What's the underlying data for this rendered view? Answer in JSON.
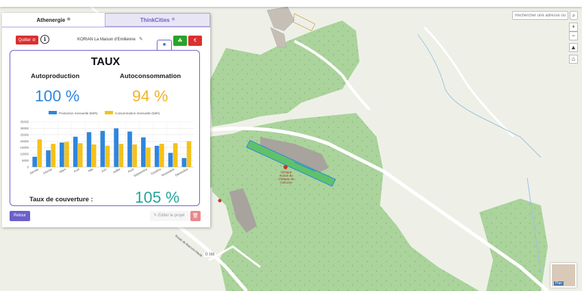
{
  "tabs": [
    {
      "label": "Athenergie",
      "icon": "registered-icon"
    },
    {
      "label": "ThinkCities",
      "icon": "registered-icon"
    }
  ],
  "toolbar": {
    "quit_label": "Quitter",
    "project_name": "KORIAN La Maison d'Emilienne"
  },
  "card": {
    "title": "TAUX",
    "autoproduction_label": "Autoproduction",
    "autoproduction_value": "100 %",
    "autoconsommation_label": "Autoconsommation",
    "autoconsommation_value": "94 %",
    "taux_label": "Taux de couverture :",
    "taux_value": "105 %"
  },
  "footer": {
    "retour_label": "Retour",
    "editer_label": "Editer le projet"
  },
  "map": {
    "search_placeholder": "Rechercher une adresse ou coo",
    "poi_label": "Clinique Korian du Château de Cahuzac",
    "road_label": "D 150",
    "road_label_2": "Route de Marcoin-Haute",
    "minimap_label": "Plan"
  },
  "colors": {
    "accent": "#6b60c8",
    "production": "#2e86de",
    "consumption": "#f5c21b",
    "autoprod": "#2e86de",
    "autoconso": "#f0b429",
    "taux": "#26a69a"
  },
  "chart_data": {
    "type": "bar",
    "categories": [
      "Janvier",
      "Février",
      "Mars",
      "Avril",
      "Mai",
      "Juin",
      "Juillet",
      "Aout",
      "Septembre",
      "Octobre",
      "Novembre",
      "Décembre"
    ],
    "series": [
      {
        "name": "Production mensuelle (kWh)",
        "values": [
          8000,
          13000,
          19000,
          23500,
          27000,
          28000,
          30000,
          27500,
          23000,
          16500,
          11000,
          7000
        ]
      },
      {
        "name": "Consommation mensuelle (kWh)",
        "values": [
          21500,
          18000,
          19500,
          18500,
          17500,
          16500,
          18000,
          17500,
          15000,
          18000,
          18500,
          20000
        ]
      }
    ],
    "ylim": [
      0,
      35000
    ],
    "yticks": [
      0,
      5000,
      10000,
      15000,
      20000,
      25000,
      30000,
      35000
    ],
    "legend": "top",
    "grid": true
  }
}
